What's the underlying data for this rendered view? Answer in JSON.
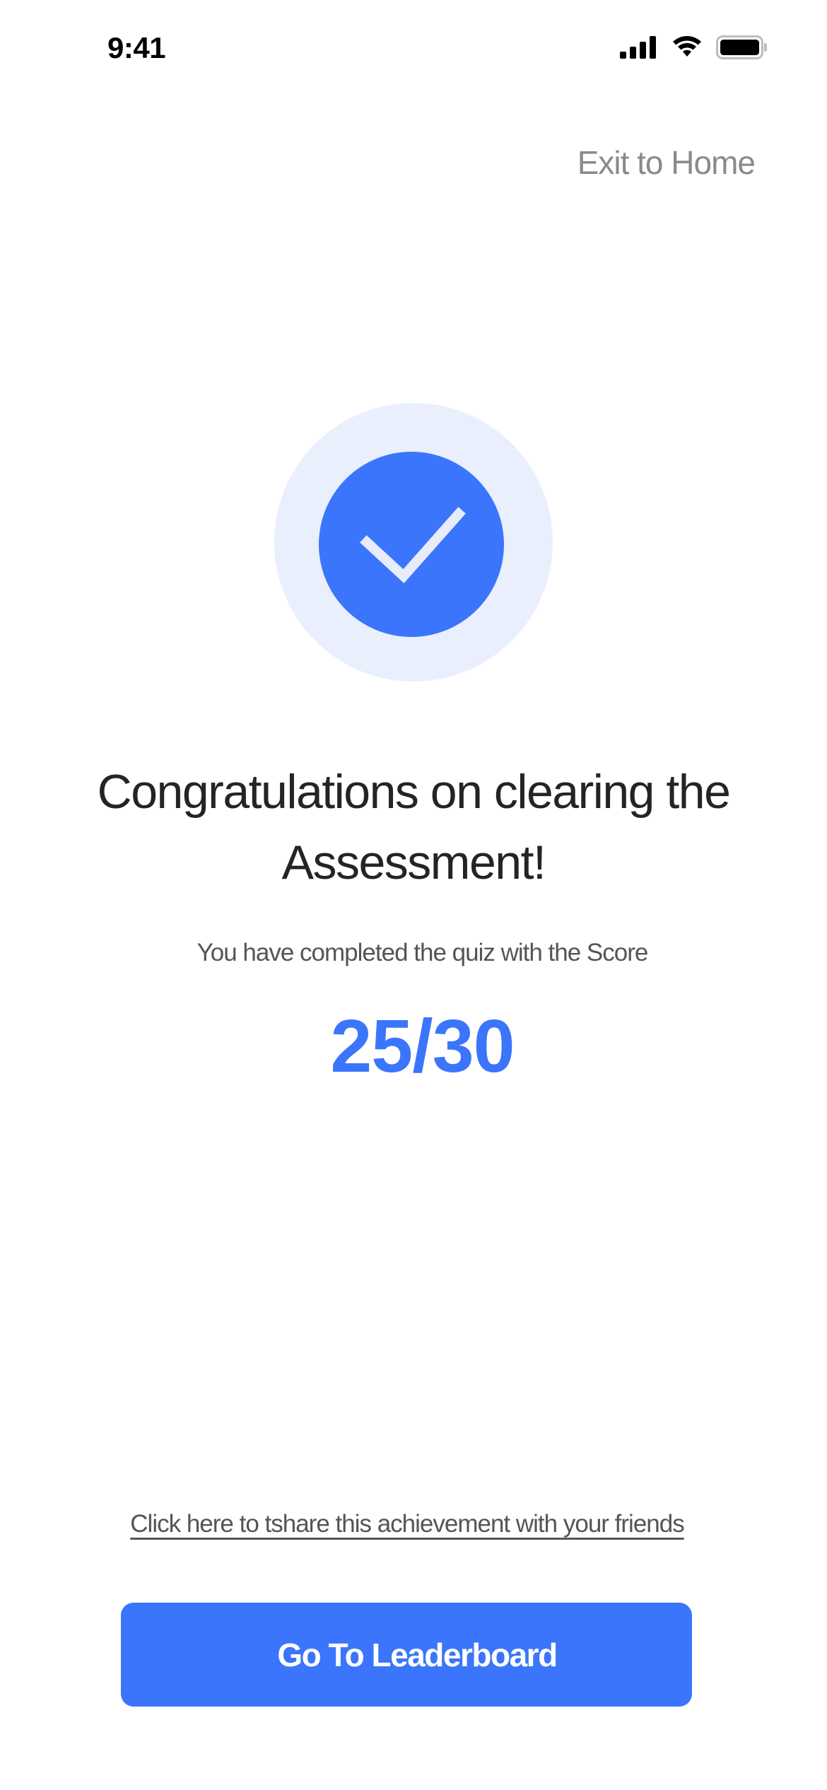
{
  "status_bar": {
    "time": "9:41",
    "icons": [
      "cellular-signal-icon",
      "wifi-icon",
      "battery-icon"
    ]
  },
  "header": {
    "exit_label": "Exit to Home"
  },
  "result": {
    "badge_icon": "checkmark-icon",
    "title": "Congratulations on clearing the Assessment!",
    "subtitle": "You have completed the quiz with the Score",
    "score": "25/30"
  },
  "footer": {
    "share_label": "Click here to tshare this achievement with your friends",
    "leaderboard_button_label": "Go To Leaderboard"
  },
  "colors": {
    "accent": "#3b75fb",
    "badge_bg": "#e9effd",
    "text_primary": "#242424",
    "text_secondary": "#555555",
    "text_muted": "#8a8a8a"
  }
}
